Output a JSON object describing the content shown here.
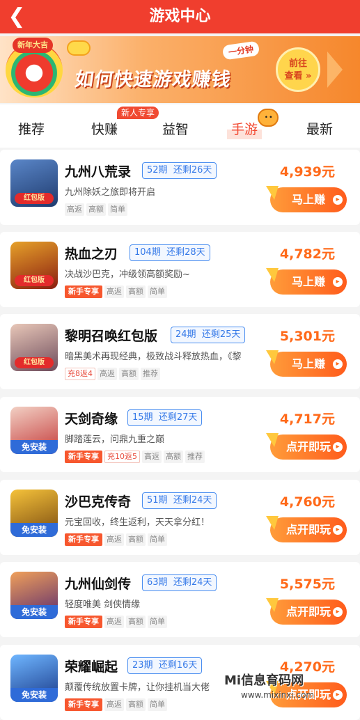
{
  "header": {
    "title": "游戏中心",
    "back_icon": "chevron-left-icon"
  },
  "banner": {
    "mascot_label": "新年大吉",
    "tag": "一分钟",
    "headline": "如何快速游戏赚钱",
    "cta_line1": "前往",
    "cta_line2": "查看 »"
  },
  "tabs": {
    "items": [
      {
        "label": "推荐"
      },
      {
        "label": "快赚",
        "badge": "新人专享"
      },
      {
        "label": "益智"
      },
      {
        "label": "手游",
        "active": true
      },
      {
        "label": "最新"
      }
    ]
  },
  "games": [
    {
      "name": "九州八荒录",
      "period": "52期",
      "remaining": "还剩26天",
      "desc": "九州除妖之旅即将开启",
      "tags": [
        "高返",
        "高额",
        "简单"
      ],
      "novice": false,
      "refund": "",
      "price": "4,939元",
      "button": "马上赚",
      "icon_label": "红包版",
      "icon_style": "red",
      "icon_colors": [
        "#5a86c8",
        "#1f3b6e"
      ]
    },
    {
      "name": "热血之刃",
      "period": "104期",
      "remaining": "还剩28天",
      "desc": "决战沙巴克，冲级领高额奖励~",
      "tags": [
        "高返",
        "高额",
        "简单"
      ],
      "novice": true,
      "refund": "",
      "price": "4,782元",
      "button": "马上赚",
      "icon_label": "红包版",
      "icon_style": "red",
      "icon_colors": [
        "#e6a12a",
        "#8a1e10"
      ]
    },
    {
      "name": "黎明召唤红包版",
      "period": "24期",
      "remaining": "还剩25天",
      "desc": "暗黑美术再现经典，极致战斗释放热血，《黎",
      "tags": [
        "高返",
        "高额",
        "推荐"
      ],
      "novice": false,
      "refund": "充8返4",
      "price": "5,301元",
      "button": "马上赚",
      "icon_label": "红包版",
      "icon_style": "red",
      "icon_colors": [
        "#e8c7b8",
        "#6e4c5c"
      ]
    },
    {
      "name": "天剑奇缘",
      "period": "15期",
      "remaining": "还剩27天",
      "desc": "脚踏莲云，问鼎九重之巅",
      "tags": [
        "高返",
        "高额",
        "推荐"
      ],
      "novice": true,
      "refund": "充10返5",
      "price": "4,717元",
      "button": "点开即玩",
      "icon_label": "免安装",
      "icon_style": "blue",
      "icon_colors": [
        "#f2d0c4",
        "#c43a3a"
      ]
    },
    {
      "name": "沙巴克传奇",
      "period": "51期",
      "remaining": "还剩24天",
      "desc": "元宝回收，终生返利，天天拿分红！",
      "tags": [
        "高返",
        "高额",
        "简单"
      ],
      "novice": true,
      "refund": "",
      "price": "4,760元",
      "button": "点开即玩",
      "icon_label": "免安装",
      "icon_style": "blue",
      "icon_colors": [
        "#f5c23a",
        "#7a4a10"
      ]
    },
    {
      "name": "九州仙剑传",
      "period": "63期",
      "remaining": "还剩24天",
      "desc": "轻度唯美 剑侠情缘",
      "tags": [
        "高返",
        "高额",
        "简单"
      ],
      "novice": true,
      "refund": "",
      "price": "5,575元",
      "button": "点开即玩",
      "icon_label": "免安装",
      "icon_style": "blue",
      "icon_colors": [
        "#f0a05a",
        "#5a2a6e"
      ]
    },
    {
      "name": "荣耀崛起",
      "period": "23期",
      "remaining": "还剩16天",
      "desc": "颠覆传统放置卡牌，让你挂机当大佬",
      "tags": [
        "高返",
        "高额",
        "简单"
      ],
      "novice": true,
      "refund": "",
      "price": "4,270元",
      "button": "点开即玩",
      "icon_label": "免安装",
      "icon_style": "blue",
      "icon_colors": [
        "#6fb6ff",
        "#1a3a8a"
      ]
    }
  ],
  "watermark": {
    "line1": "Mi信息育码网",
    "line2": "www.mixinxi.com"
  },
  "colors": {
    "brand_red": "#f03e2e",
    "price_orange": "#ff6a1a",
    "period_blue": "#3579e8"
  }
}
